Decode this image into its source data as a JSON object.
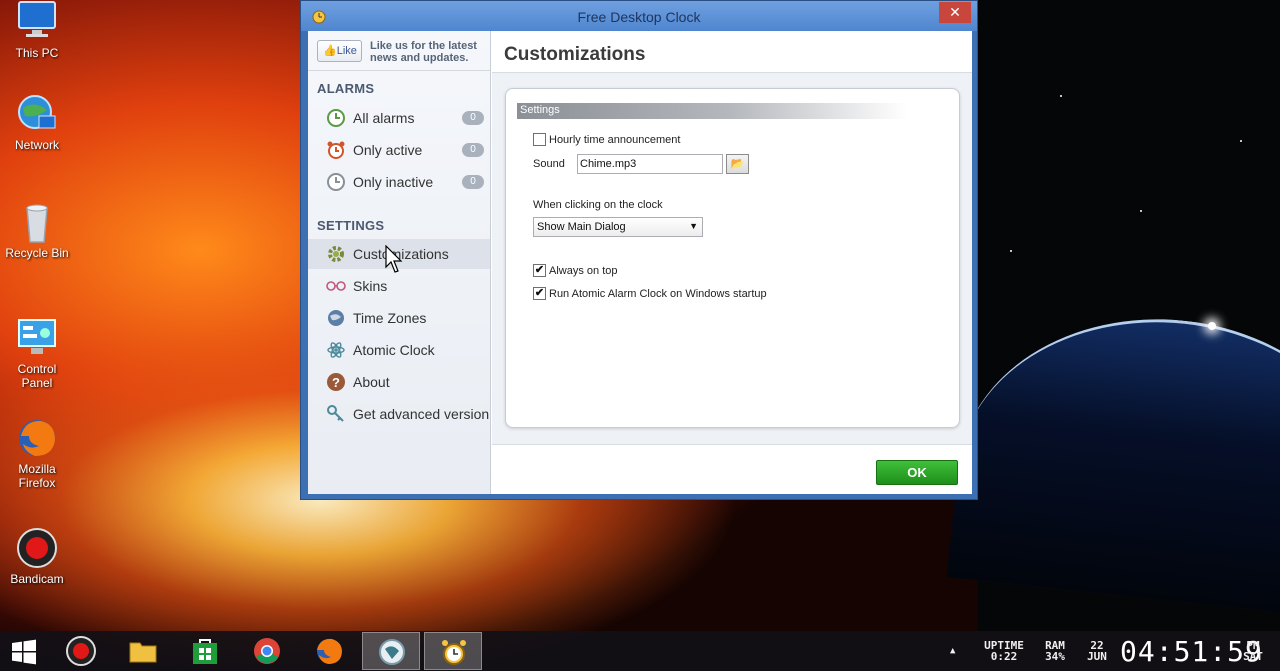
{
  "desktop": {
    "icons": [
      {
        "label": "This PC"
      },
      {
        "label": "Network"
      },
      {
        "label": "Recycle Bin"
      },
      {
        "label": "Control Panel"
      },
      {
        "label": "Mozilla Firefox"
      },
      {
        "label": "Bandicam"
      }
    ]
  },
  "window": {
    "title": "Free Desktop Clock",
    "close_label": "✕"
  },
  "sidebar": {
    "like_button": "Like",
    "like_text": "Like us for the latest news and updates.",
    "alarms_heading": "ALARMS",
    "alarm_items": [
      {
        "label": "All alarms",
        "count": "0"
      },
      {
        "label": "Only active",
        "count": "0"
      },
      {
        "label": "Only inactive",
        "count": "0"
      }
    ],
    "settings_heading": "SETTINGS",
    "settings_items": [
      {
        "label": "Customizations",
        "icon": "gear-icon"
      },
      {
        "label": "Skins",
        "icon": "glasses-icon"
      },
      {
        "label": "Time Zones",
        "icon": "globe-icon"
      },
      {
        "label": "Atomic Clock",
        "icon": "atom-icon"
      },
      {
        "label": "About",
        "icon": "question-icon"
      },
      {
        "label": "Get advanced version",
        "icon": "key-icon"
      }
    ]
  },
  "main": {
    "heading": "Customizations",
    "group_title": "Settings",
    "hourly_label": "Hourly time announcement",
    "hourly_checked": false,
    "sound_label": "Sound",
    "sound_value": "Chime.mp3",
    "click_label": "When clicking on the clock",
    "click_option": "Show Main Dialog",
    "always_on_top_label": "Always on top",
    "always_on_top_checked": true,
    "startup_label": "Run Atomic Alarm Clock on Windows startup",
    "startup_checked": true,
    "ok_label": "OK"
  },
  "taskbar": {
    "tray_arrow": "▲",
    "uptime_label": "UPTIME",
    "uptime_value": "0:22",
    "ram_label": "RAM",
    "ram_value": "34%",
    "date_day": "22",
    "date_month": "JUN",
    "time": "04:51:59",
    "ampm": "PM",
    "weekday": "SAT"
  }
}
